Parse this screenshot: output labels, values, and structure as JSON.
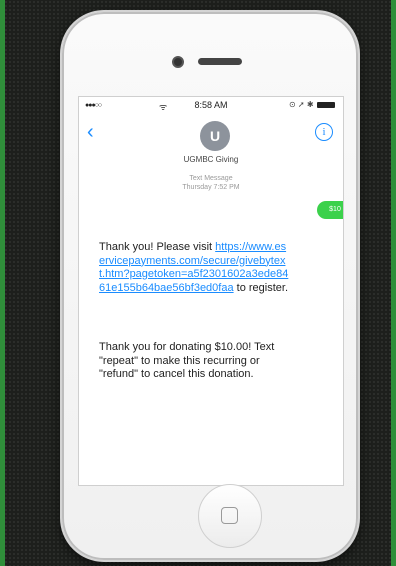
{
  "status_bar": {
    "signal": "●●●○○",
    "wifi": "ᯤ",
    "time": "8:58 AM",
    "indicators": "⊙ ➚ ✱"
  },
  "conversation": {
    "back": "‹",
    "avatar_initial": "U",
    "contact_name": "UGMBC Giving",
    "info": "i",
    "meta_line1": "Text Message",
    "meta_line2": "Thursday 7:52 PM",
    "sent_text": "$10",
    "received": {
      "m1_before": "Thank you! Please visit ",
      "link": "https://www.eservicepayments.com/secure/givebytext.htm?pagetoken=a5f2301602a3ede8461e155b64bae56bf3ed0faa",
      "m1_after": " to register.",
      "m2": "Thank you for donating $10.00! Text \"repeat\" to make this recurring or \"refund\" to cancel this donation."
    }
  },
  "colors": {
    "ios_blue": "#1a8cff",
    "sent_bubble": "#3bd14b",
    "avatar": "#8d939c"
  }
}
